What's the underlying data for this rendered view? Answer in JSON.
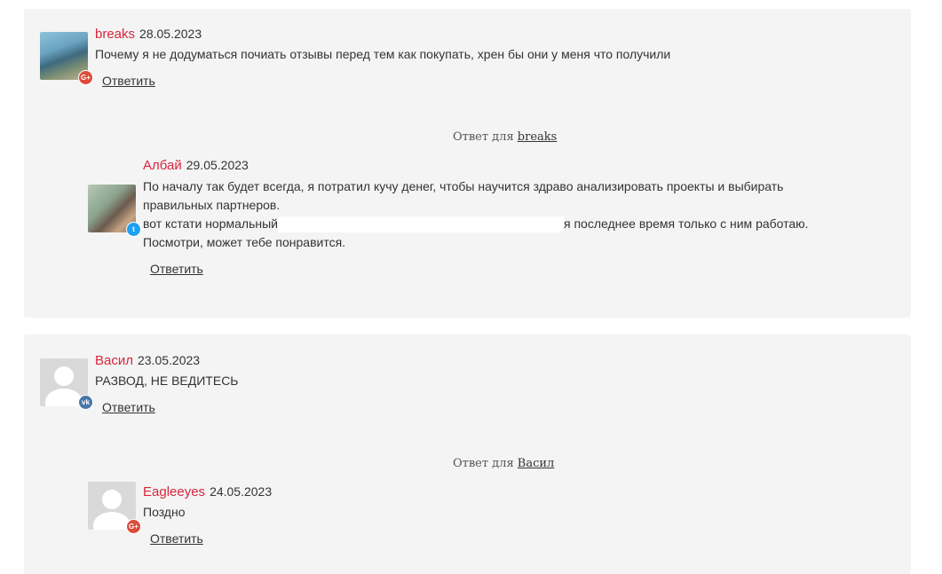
{
  "thread1": {
    "comment": {
      "author": "breaks",
      "date": "28.05.2023",
      "text": "Почему я не додуматься почиать отзывы перед тем как покупать, хрен бы они у меня что получили",
      "reply_label": "Ответить",
      "badge_icon": "google-plus-icon",
      "badge_glyph": "G+"
    },
    "reply_for": {
      "prefix": "Ответ для",
      "target": "breaks"
    },
    "reply": {
      "author": "Албай",
      "date": "29.05.2023",
      "line1": "По началу так будет всегда, я потратил кучу денег, чтобы научится здраво анализировать проекты и выбирать",
      "line2": "правильных партнеров.",
      "line3_start": "вот кстати нормальный",
      "line3_end": "я последнее время только с ним работаю.",
      "line4": "Посмотри, может тебе понравится.",
      "reply_label": "Ответить",
      "badge_icon": "twitter-icon",
      "badge_glyph": "t"
    }
  },
  "thread2": {
    "comment": {
      "author": "Васил",
      "date": "23.05.2023",
      "text": "РАЗВОД, НЕ ВЕДИТЕСЬ",
      "reply_label": "Ответить",
      "badge_icon": "vk-icon",
      "badge_glyph": "vk"
    },
    "reply_for": {
      "prefix": "Ответ для",
      "target": "Васил"
    },
    "reply": {
      "author": "Eagleeyes",
      "date": "24.05.2023",
      "text": "Поздно",
      "reply_label": "Ответить",
      "badge_icon": "google-plus-icon",
      "badge_glyph": "G+"
    }
  },
  "colors": {
    "author": "#d7263d",
    "card_background": "#f4f4f4",
    "google_plus": "#dd4b39",
    "twitter": "#1da1f2",
    "vk": "#4a76a8"
  }
}
